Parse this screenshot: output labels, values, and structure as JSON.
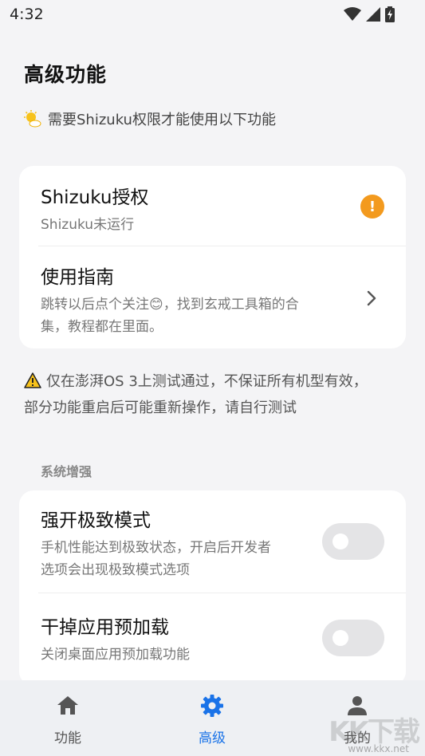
{
  "status": {
    "time": "4:32"
  },
  "page": {
    "title": "高级功能",
    "notice": "需要Shizuku权限才能使用以下功能"
  },
  "shizuku_card": {
    "title": "Shizuku授权",
    "subtitle": "Shizuku未运行",
    "badge": "!",
    "badge_color": "#f39a1e",
    "guide_title": "使用指南",
    "guide_sub_line1": "跳转以后点个关注😊，找到玄戒工具箱的合",
    "guide_sub_line2": "集，教程都在里面。"
  },
  "warning": {
    "line1": "仅在澎湃OS 3上测试通过，不保证所有机型有效，",
    "line2": "部分功能重启后可能重新操作，请自行测试"
  },
  "section": {
    "title": "系统增强"
  },
  "settings": [
    {
      "title": "强开极致模式",
      "sub_line1": "手机性能达到极致状态，开启后开发者",
      "sub_line2": "选项会出现极致模式选项",
      "enabled": false
    },
    {
      "title": "干掉应用预加载",
      "sub_line1": "关闭桌面应用预加载功能",
      "sub_line2": "",
      "enabled": false
    }
  ],
  "nav": [
    {
      "label": "功能",
      "icon": "home-icon",
      "active": false
    },
    {
      "label": "高级",
      "icon": "gear-icon",
      "active": true
    },
    {
      "label": "我的",
      "icon": "person-icon",
      "active": false
    }
  ],
  "accent_color": "#1a73e8",
  "watermark": {
    "logo": "KK下载",
    "url": "www.kkx.net"
  }
}
